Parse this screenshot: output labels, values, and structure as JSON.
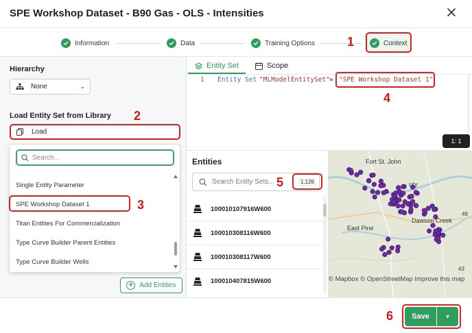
{
  "dialog": {
    "title": "SPE Workshop Dataset - B90 Gas - OLS - Intensities"
  },
  "stepper": {
    "steps": [
      {
        "label": "Information"
      },
      {
        "label": "Data"
      },
      {
        "label": "Training Options"
      },
      {
        "label": "Context"
      }
    ]
  },
  "annotations": [
    "1",
    "2",
    "3",
    "4",
    "5",
    "6"
  ],
  "left_panel": {
    "hierarchy_label": "Hierarchy",
    "hierarchy_value": "None",
    "library_label": "Load Entity Set from Library",
    "load_label": "Load",
    "search_placeholder": "Search...",
    "library_items": [
      "Single Entity Parameter",
      "SPE Workshop Dataset 1",
      "Titan Entities For Commercialization",
      "Type Curve Builder Parent Entities",
      "Type Curve Builder Wells"
    ],
    "add_entities_label": "Add Entities"
  },
  "editor": {
    "tabs": [
      "Entity Set",
      "Scope"
    ],
    "line_number": "1",
    "code_keyword": "Entity Set",
    "code_name": "\"MLModelEntitySet\"",
    "code_eq": "=",
    "code_value": "\"SPE Workshop Dataset 1\"",
    "position": "1: 1"
  },
  "entities": {
    "title": "Entities",
    "search_placeholder": "Search Entity Sets...",
    "count": "1,126",
    "rows": [
      "100010107916W600",
      "100010308116W600",
      "100010308117W600",
      "100010407815W600"
    ]
  },
  "map": {
    "labels": {
      "city1": "Fort St. John",
      "city2": "East Pine",
      "city3": "Dawson Creek",
      "road1": "49",
      "road2": "43",
      "partial1": "ury",
      "partial2": "eek"
    },
    "attribution": "© Mapbox © OpenStreetMap Improve this map",
    "point_color": "#6a2ca0"
  },
  "footer": {
    "save_label": "Save"
  },
  "colors": {
    "accent": "#2e9d5e",
    "annotation": "#e21d1d"
  }
}
